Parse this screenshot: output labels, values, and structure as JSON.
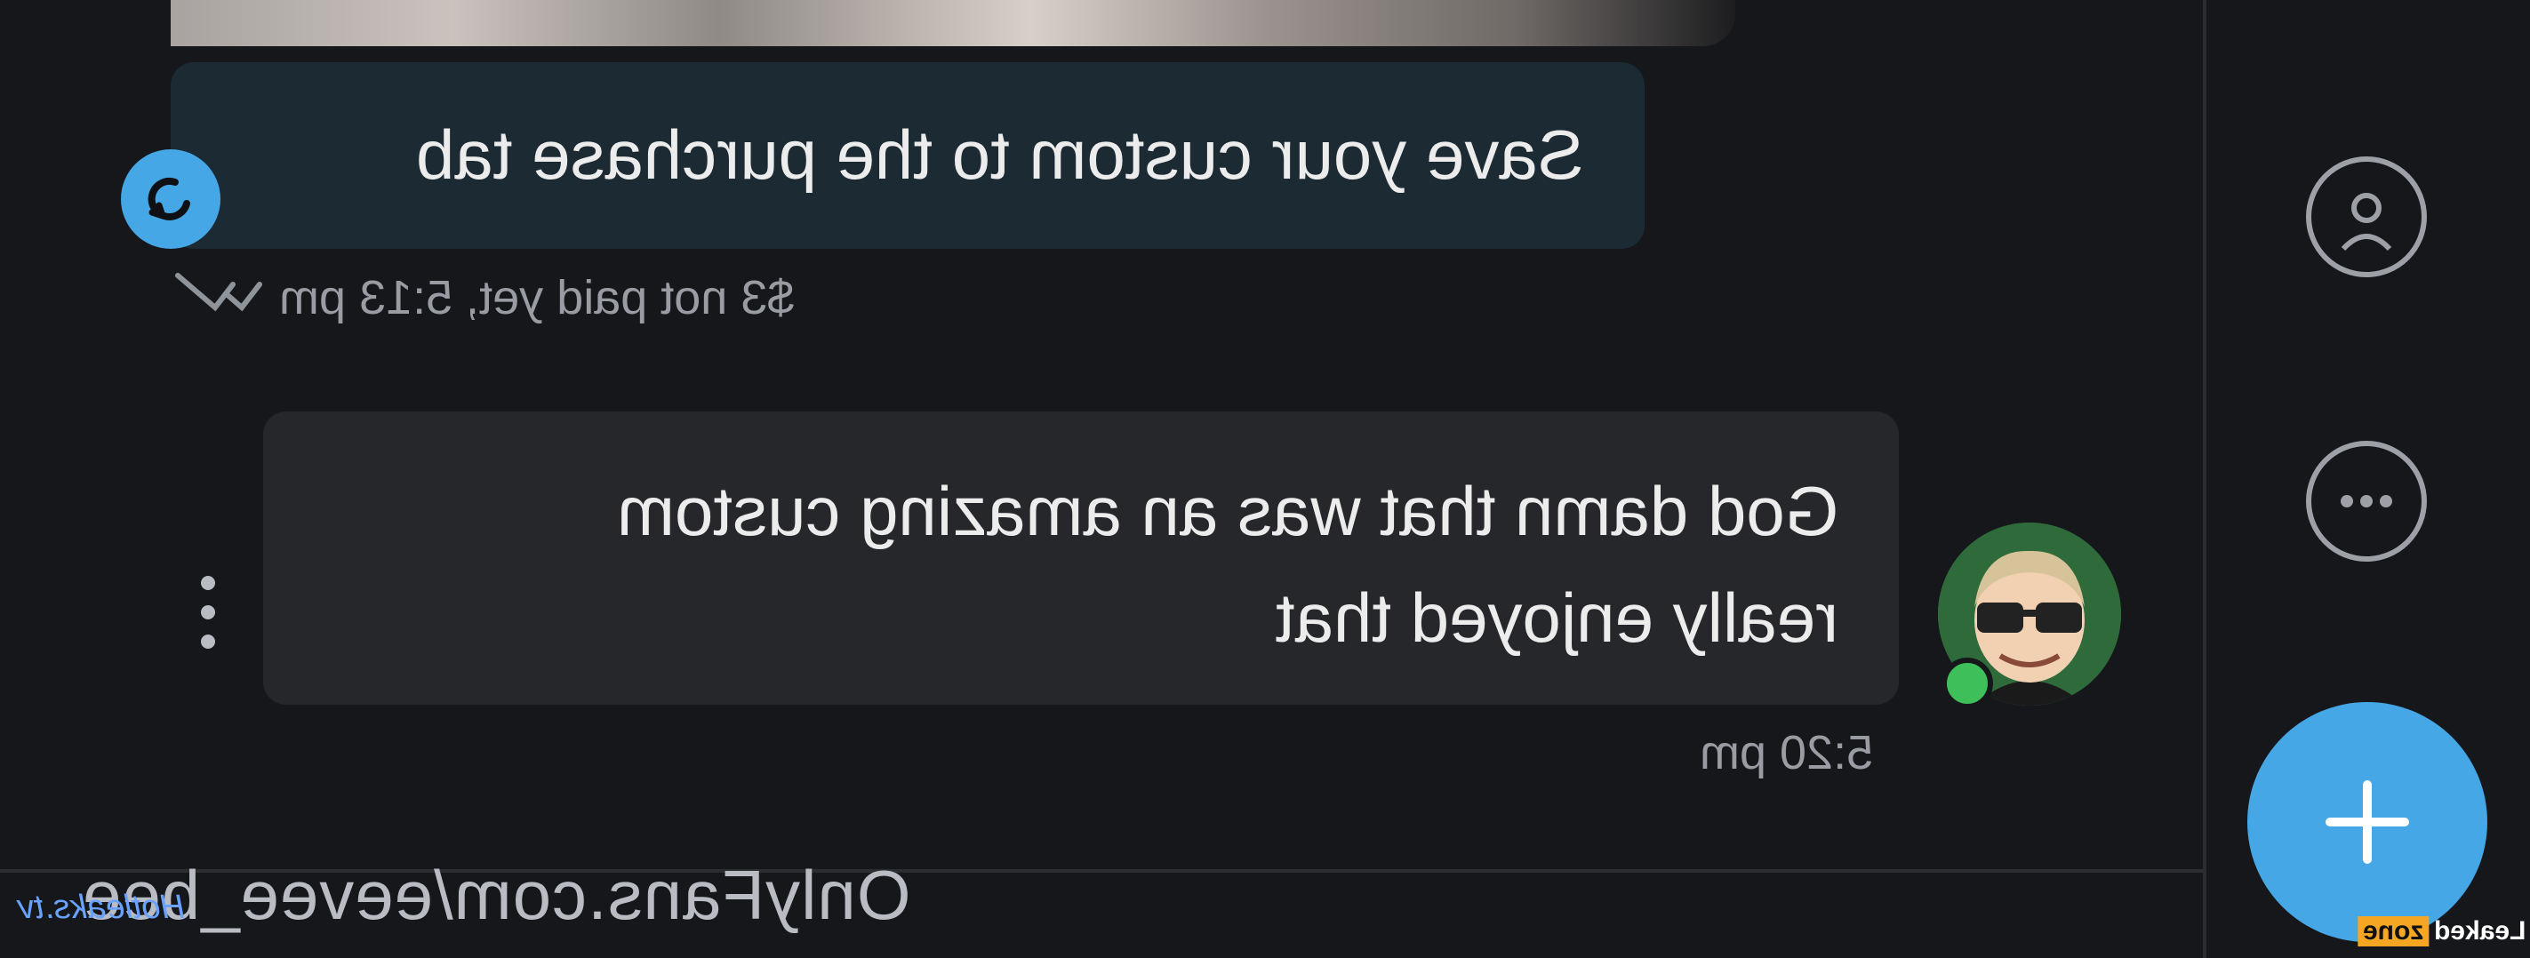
{
  "messages": [
    {
      "direction": "sent",
      "text": "Save your custom to the purchase tab",
      "meta": "$3 not paid yet, 5:13 pm"
    },
    {
      "direction": "received",
      "line1": "God damn that was an amazing custom",
      "line2": "really enjoyed that",
      "time": "5:20 pm"
    }
  ],
  "footer": {
    "url": "OnlyFans.com/eevee_bee"
  },
  "watermarks": {
    "left": "Hotleaks.tv",
    "right_a": "Leaked",
    "right_b": "zone"
  },
  "icons": {
    "retry": "retry-icon",
    "double_check": "double-check-icon",
    "more_vertical": "more-vertical-icon",
    "profile": "profile-icon",
    "more_horizontal": "more-horizontal-icon",
    "add": "add-icon"
  },
  "colors": {
    "background": "#16171b",
    "sent_bubble": "#1b2a33",
    "received_bubble": "#26272b",
    "accent": "#46a7e6",
    "online": "#3fbf5a"
  }
}
